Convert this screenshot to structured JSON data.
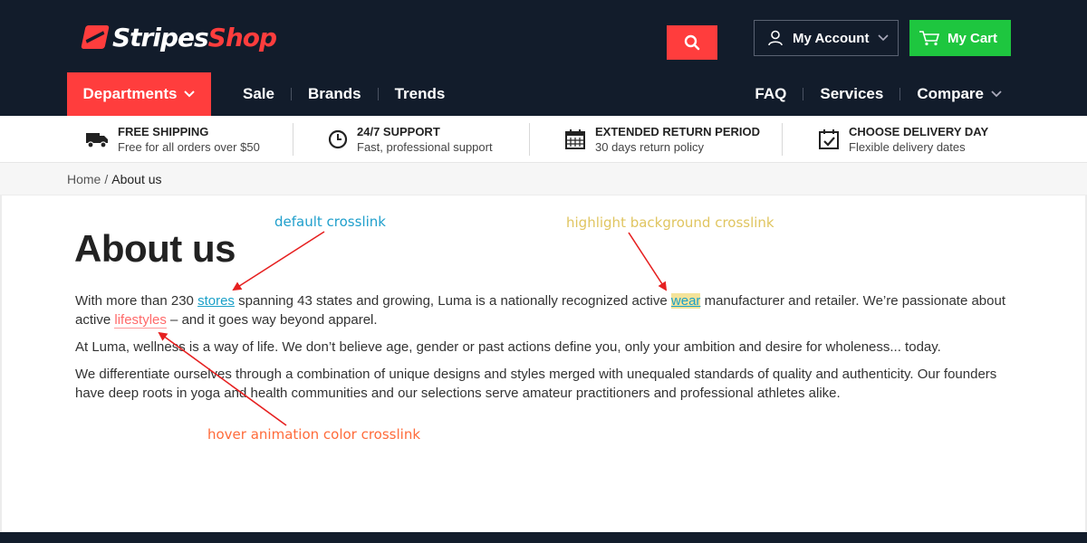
{
  "header": {
    "logo": {
      "part1": "Stripes",
      "part2": "Shop"
    },
    "account_label": "My Account",
    "cart_label": "My Cart",
    "departments_label": "Departments",
    "nav_left": [
      "Sale",
      "Brands",
      "Trends"
    ],
    "nav_right": [
      "FAQ",
      "Services",
      "Compare"
    ]
  },
  "features": [
    {
      "title": "FREE SHIPPING",
      "subtitle": "Free for all orders over $50",
      "icon": "truck-icon"
    },
    {
      "title": "24/7 SUPPORT",
      "subtitle": "Fast, professional support",
      "icon": "clock-icon"
    },
    {
      "title": "EXTENDED RETURN PERIOD",
      "subtitle": "30 days return policy",
      "icon": "calendar-icon"
    },
    {
      "title": "CHOOSE DELIVERY DAY",
      "subtitle": "Flexible delivery dates",
      "icon": "calendar-check-icon"
    }
  ],
  "breadcrumb": {
    "home": "Home",
    "separator": "/",
    "current": "About us"
  },
  "page": {
    "title": "About us",
    "p1": {
      "t1": "With more than 230 ",
      "link_stores": "stores",
      "t2": " spanning 43 states and growing, Luma is a nationally recognized active ",
      "link_wear": "wear",
      "t3": " manufacturer and retailer. We’re passionate about active ",
      "link_lifestyles": "lifestyles",
      "t4": " – and it goes way beyond apparel."
    },
    "p2": "At Luma, wellness is a way of life. We don’t believe age, gender or past actions define you, only your ambition and desire for wholeness... today.",
    "p3": "We differentiate ourselves through a combination of unique designs and styles merged with unequaled standards of quality and authenticity. Our founders have deep roots in yoga and health communities and our selections serve amateur practitioners and professional athletes alike."
  },
  "annotations": {
    "default": "default crosslink",
    "highlight": "highlight background crosslink",
    "hover": "hover animation color crosslink"
  },
  "colors": {
    "header_bg": "#121c2b",
    "accent_red": "#ff3d3d",
    "cart_green": "#1ec63f",
    "link_blue": "#1aa0c8",
    "highlight_bg": "#f4e39a",
    "hover_link": "#ff6a6a",
    "arrow_red": "#e62020"
  }
}
